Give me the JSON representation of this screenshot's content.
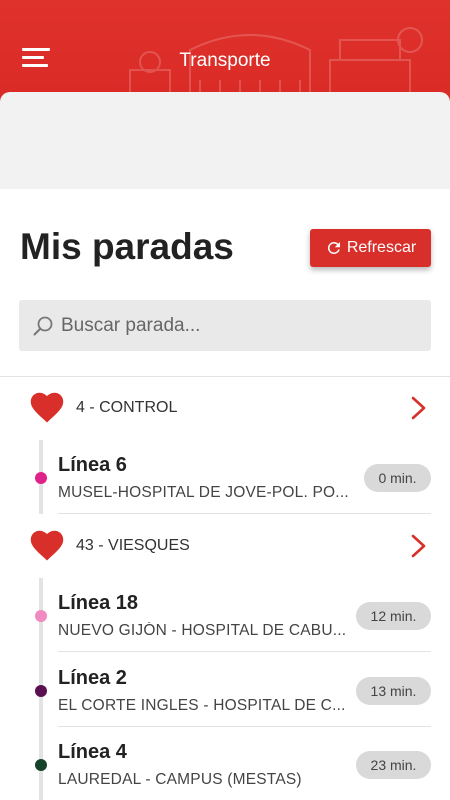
{
  "header": {
    "title": "Transporte"
  },
  "page": {
    "title": "Mis paradas",
    "refresh_label": "Refrescar"
  },
  "search": {
    "placeholder": "Buscar parada..."
  },
  "stops": [
    {
      "number": "4",
      "name": "CONTROL",
      "label": "4 - CONTROL",
      "lines": [
        {
          "name": "Línea 6",
          "route": "MUSEL-HOSPITAL DE JOVE-POL. PO...",
          "eta": "0 min.",
          "color": "#e0218a"
        }
      ]
    },
    {
      "number": "43",
      "name": "VIESQUES",
      "label": "43 - VIESQUES",
      "lines": [
        {
          "name": "Línea 18",
          "route": "NUEVO GIJÓN - HOSPITAL DE CABU...",
          "eta": "12 min.",
          "color": "#f08ac0"
        },
        {
          "name": "Línea 2",
          "route": "EL CORTE INGLES - HOSPITAL DE C...",
          "eta": "13 min.",
          "color": "#5a1050"
        },
        {
          "name": "Línea 4",
          "route": "LAUREDAL - CAMPUS (MESTAS)",
          "eta": "23 min.",
          "color": "#14432a"
        }
      ]
    }
  ],
  "colors": {
    "brand": "#d92f2a",
    "background": "#ffffff",
    "chip": "#d9d9d9"
  },
  "icons": {
    "menu": "menu-icon",
    "refresh": "refresh-icon",
    "search": "search-icon",
    "favorite": "heart-icon",
    "navigate": "chevron-right-icon"
  }
}
